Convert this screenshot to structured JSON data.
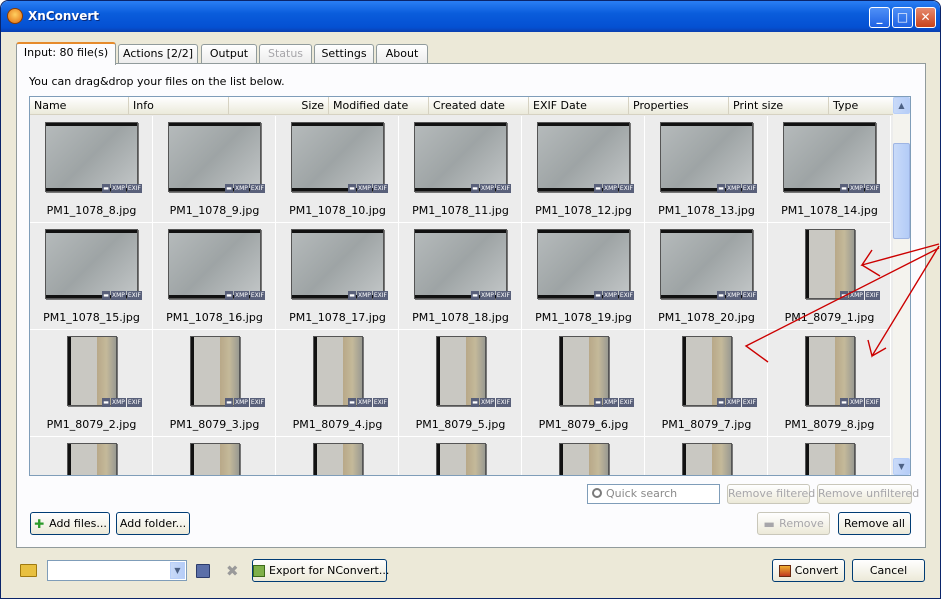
{
  "window": {
    "title": "XnConvert"
  },
  "tabs": [
    "Input: 80 file(s)",
    "Actions [2/2]",
    "Output",
    "Status",
    "Settings",
    "About"
  ],
  "hint": "You can drag&drop your files on the list below.",
  "columns": [
    "Name",
    "Info",
    "Size",
    "Modified date",
    "Created date",
    "EXIF Date",
    "Properties",
    "Print size",
    "Type"
  ],
  "files": [
    "PM1_1078_8.jpg",
    "PM1_1078_9.jpg",
    "PM1_1078_10.jpg",
    "PM1_1078_11.jpg",
    "PM1_1078_12.jpg",
    "PM1_1078_13.jpg",
    "PM1_1078_14.jpg",
    "PM1_1078_15.jpg",
    "PM1_1078_16.jpg",
    "PM1_1078_17.jpg",
    "PM1_1078_18.jpg",
    "PM1_1078_19.jpg",
    "PM1_1078_20.jpg",
    "PM1_8079_1.jpg",
    "PM1_8079_2.jpg",
    "PM1_8079_3.jpg",
    "PM1_8079_4.jpg",
    "PM1_8079_5.jpg",
    "PM1_8079_6.jpg",
    "PM1_8079_7.jpg",
    "PM1_8079_8.jpg",
    "",
    "",
    "",
    "",
    "",
    "",
    ""
  ],
  "orientation": [
    "L",
    "L",
    "L",
    "L",
    "L",
    "L",
    "L",
    "L",
    "L",
    "L",
    "L",
    "L",
    "L",
    "P",
    "P",
    "P",
    "P",
    "P",
    "P",
    "P",
    "P",
    "P",
    "P",
    "P",
    "P",
    "P",
    "P",
    "P"
  ],
  "badges": {
    "xmp": "XMP",
    "exif": "EXIF"
  },
  "search": {
    "placeholder": "Quick search"
  },
  "buttons": {
    "remove_filtered": "Remove filtered",
    "remove_unfiltered": "Remove unfiltered",
    "add_files": "Add files...",
    "add_folder": "Add folder...",
    "remove": "Remove",
    "remove_all": "Remove all",
    "export": "Export for NConvert...",
    "convert": "Convert",
    "cancel": "Cancel"
  },
  "icons": [
    "app-icon",
    "minimize-icon",
    "maximize-icon",
    "close-icon",
    "search-icon",
    "add-icon",
    "remove-icon",
    "folder-icon",
    "save-icon",
    "delete-icon",
    "export-icon",
    "convert-icon"
  ],
  "colors": {
    "accent": "#0a5ddc",
    "annotation": "#cc0000"
  }
}
